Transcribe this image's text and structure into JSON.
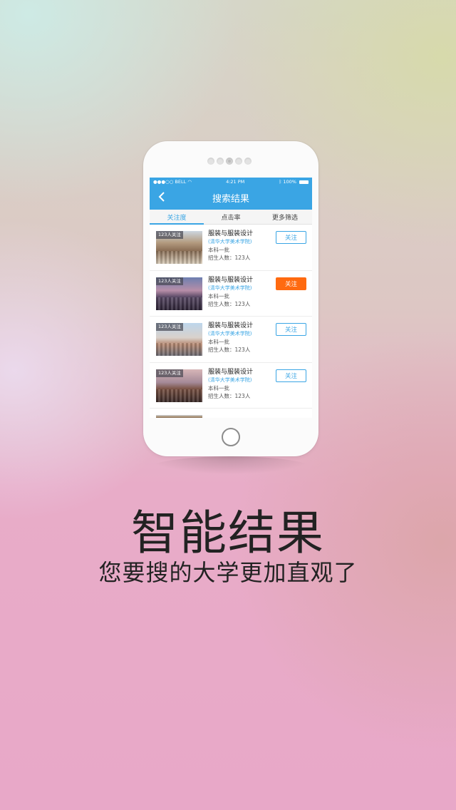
{
  "status_bar": {
    "carrier": "●●●○○ BELL",
    "time": "4:21 PM",
    "battery": "100%"
  },
  "nav": {
    "back_icon": "chevron-left-icon",
    "title": "搜索结果"
  },
  "tabs": [
    {
      "label": "关注度",
      "active": true
    },
    {
      "label": "点击率",
      "active": false
    },
    {
      "label": "更多筛选",
      "active": false
    }
  ],
  "results": [
    {
      "badge": "123人关注",
      "name": "服装与服装设计",
      "school": "(清华大学美术学院)",
      "batch": "本科一批",
      "enroll": "招生人数：123人",
      "follow_label": "关注",
      "followed": false
    },
    {
      "badge": "123人关注",
      "name": "服装与服装设计",
      "school": "(清华大学美术学院)",
      "batch": "本科一批",
      "enroll": "招生人数：123人",
      "follow_label": "关注",
      "followed": true
    },
    {
      "badge": "123人关注",
      "name": "服装与服装设计",
      "school": "(清华大学美术学院)",
      "batch": "本科一批",
      "enroll": "招生人数：123人",
      "follow_label": "关注",
      "followed": false
    },
    {
      "badge": "123人关注",
      "name": "服装与服装设计",
      "school": "(清华大学美术学院)",
      "batch": "本科一批",
      "enroll": "招生人数：123人",
      "follow_label": "关注",
      "followed": false
    }
  ],
  "headline": "智能结果",
  "subline": "您要搜的大学更加直观了"
}
